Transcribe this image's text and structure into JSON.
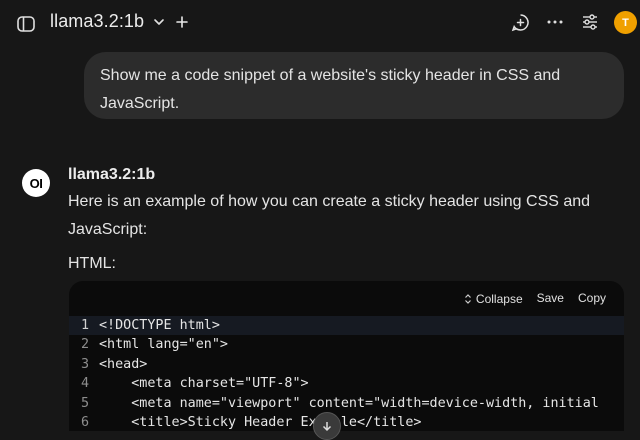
{
  "header": {
    "model_name": "llama3.2:1b",
    "avatar_initial": "T"
  },
  "user_message": "Show me a code snippet of a website's sticky header in CSS and JavaScript.",
  "assistant": {
    "name": "llama3.2:1b",
    "logo_text": "OI",
    "text": "Here is an example of how you can create a sticky header using CSS and JavaScript:",
    "section_label": "HTML:"
  },
  "code_block": {
    "actions": {
      "collapse": "Collapse",
      "save": "Save",
      "copy": "Copy"
    },
    "lines": [
      {
        "n": "1",
        "text": "<!DOCTYPE html>"
      },
      {
        "n": "2",
        "text": "<html lang=\"en\">"
      },
      {
        "n": "3",
        "text": "<head>"
      },
      {
        "n": "4",
        "text": "    <meta charset=\"UTF-8\">"
      },
      {
        "n": "5",
        "text": "    <meta name=\"viewport\" content=\"width=device-width, initial"
      },
      {
        "n": "6",
        "text": "    <title>Sticky Header Example</title>"
      }
    ]
  }
}
